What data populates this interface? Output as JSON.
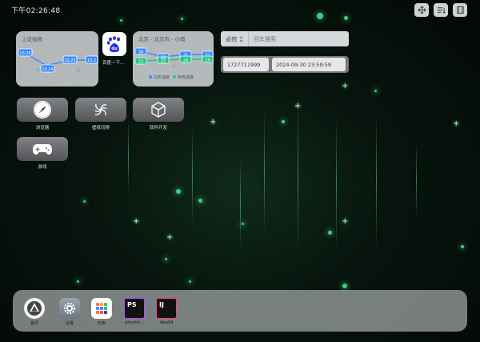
{
  "status": {
    "time": "下午02:26:48"
  },
  "top_buttons": [
    {
      "icon": "move-icon"
    },
    {
      "icon": "sort-icon"
    },
    {
      "icon": "fullscreen-icon"
    }
  ],
  "stock_widget": {
    "title": "上证指数",
    "values": [
      "10.26",
      "10.24",
      "10.25",
      "10.2"
    ]
  },
  "baidu_shortcut": {
    "label": "百度一下..."
  },
  "weather_widget": {
    "title": "北京 - 北京市 - 小雨",
    "top_values": [
      "34",
      "32",
      "31",
      "31"
    ],
    "bottom_values": [
      "23",
      "22",
      "24",
      "24"
    ],
    "legend_high": "白天温度",
    "legend_low": "夜晚温度",
    "color_high": "#3a8cff",
    "color_low": "#24c58a"
  },
  "search": {
    "engine": "必应",
    "placeholder": "回车搜索"
  },
  "timestamp_tool": {
    "timestamp": "1727711999",
    "datetime": "2024-09-30 23:59:59"
  },
  "apps": [
    {
      "label": "浏览器",
      "icon": "compass-icon"
    },
    {
      "label": "壁纸切换",
      "icon": "swirl-icon"
    },
    {
      "label": "软件开发",
      "icon": "cube-icon"
    },
    {
      "label": "游戏",
      "icon": "gamepad-icon"
    }
  ],
  "dock": {
    "items": [
      {
        "label": "首页",
        "icon": "home-logo-icon"
      },
      {
        "label": "设置",
        "icon": "gear-icon"
      },
      {
        "label": "应用",
        "icon": "grid-icon"
      },
      {
        "label": "phpstor...",
        "icon": "phpstorm-icon",
        "badge": "PS"
      },
      {
        "label": "idea64",
        "icon": "intellij-icon",
        "badge": "IJ"
      }
    ]
  }
}
